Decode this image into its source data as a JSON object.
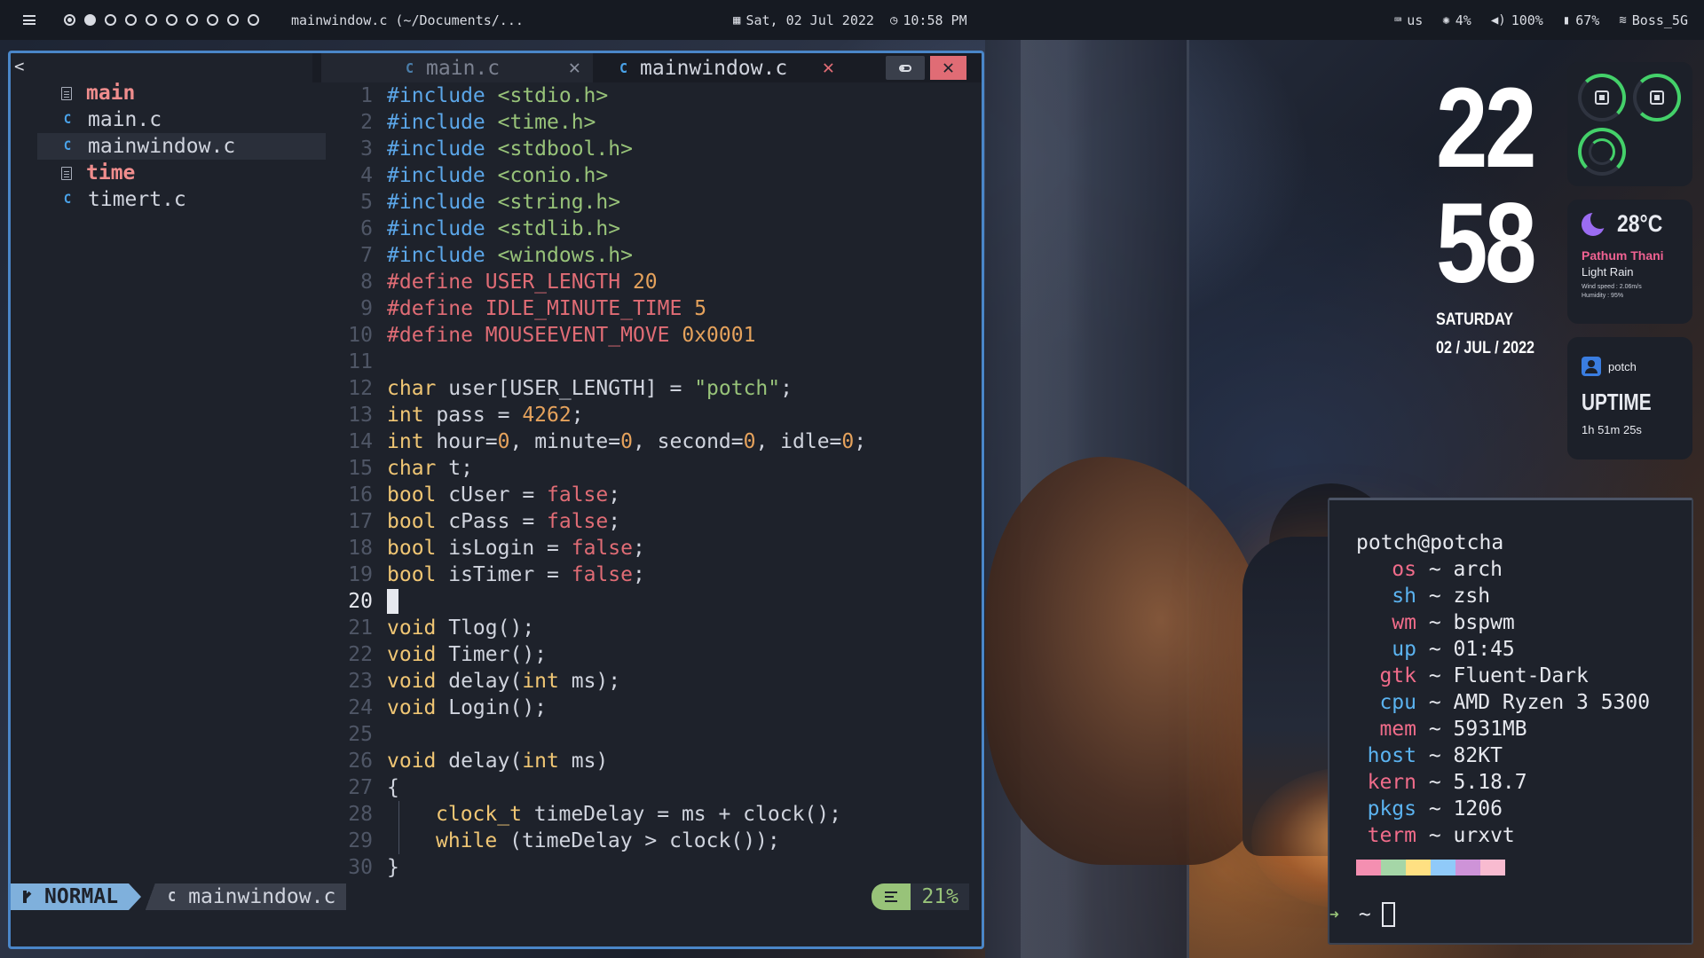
{
  "topbar": {
    "workspaces": [
      "1",
      "2",
      "3",
      "4",
      "5",
      "6",
      "7",
      "8",
      "9",
      "10"
    ],
    "window_title": "mainwindow.c (~/Documents/...",
    "date": "Sat, 02 Jul 2022",
    "time": "10:58 PM",
    "keyboard": "us",
    "brightness": "4%",
    "volume": "100%",
    "battery": "67%",
    "wifi": "Boss_5G"
  },
  "editor": {
    "tree_back": "<",
    "tree": [
      {
        "name": "main",
        "kind": "exec"
      },
      {
        "name": "main.c",
        "kind": "c"
      },
      {
        "name": "mainwindow.c",
        "kind": "c"
      },
      {
        "name": "time",
        "kind": "exec"
      },
      {
        "name": "timert.c",
        "kind": "c"
      }
    ],
    "tabs": [
      {
        "label": "main.c",
        "active": false
      },
      {
        "label": "mainwindow.c",
        "active": true
      }
    ],
    "current_line": "20",
    "lines": [
      {
        "n": "1",
        "tokens": [
          [
            "inc",
            "#include "
          ],
          [
            "hdr",
            "<stdio.h>"
          ]
        ]
      },
      {
        "n": "2",
        "tokens": [
          [
            "inc",
            "#include "
          ],
          [
            "hdr",
            "<time.h>"
          ]
        ]
      },
      {
        "n": "3",
        "tokens": [
          [
            "inc",
            "#include "
          ],
          [
            "hdr",
            "<stdbool.h>"
          ]
        ]
      },
      {
        "n": "4",
        "tokens": [
          [
            "inc",
            "#include "
          ],
          [
            "hdr",
            "<conio.h>"
          ]
        ]
      },
      {
        "n": "5",
        "tokens": [
          [
            "inc",
            "#include "
          ],
          [
            "hdr",
            "<string.h>"
          ]
        ]
      },
      {
        "n": "6",
        "tokens": [
          [
            "inc",
            "#include "
          ],
          [
            "hdr",
            "<stdlib.h>"
          ]
        ]
      },
      {
        "n": "7",
        "tokens": [
          [
            "inc",
            "#include "
          ],
          [
            "hdr",
            "<windows.h>"
          ]
        ]
      },
      {
        "n": "8",
        "tokens": [
          [
            "def",
            "#define USER_LENGTH "
          ],
          [
            "num",
            "20"
          ]
        ]
      },
      {
        "n": "9",
        "tokens": [
          [
            "def",
            "#define IDLE_MINUTE_TIME "
          ],
          [
            "num",
            "5"
          ]
        ]
      },
      {
        "n": "10",
        "tokens": [
          [
            "def",
            "#define MOUSEEVENT_MOVE "
          ],
          [
            "num",
            "0x0001"
          ]
        ]
      },
      {
        "n": "11",
        "tokens": []
      },
      {
        "n": "12",
        "tokens": [
          [
            "k2",
            "char"
          ],
          [
            "p",
            " user[USER_LENGTH] = "
          ],
          [
            "str",
            "\"potch\""
          ],
          [
            "p",
            ";"
          ]
        ]
      },
      {
        "n": "13",
        "tokens": [
          [
            "k2",
            "int"
          ],
          [
            "p",
            " pass = "
          ],
          [
            "num",
            "4262"
          ],
          [
            "p",
            ";"
          ]
        ]
      },
      {
        "n": "14",
        "tokens": [
          [
            "k2",
            "int"
          ],
          [
            "p",
            " hour="
          ],
          [
            "num",
            "0"
          ],
          [
            "p",
            ", minute="
          ],
          [
            "num",
            "0"
          ],
          [
            "p",
            ", second="
          ],
          [
            "num",
            "0"
          ],
          [
            "p",
            ", idle="
          ],
          [
            "num",
            "0"
          ],
          [
            "p",
            ";"
          ]
        ]
      },
      {
        "n": "15",
        "tokens": [
          [
            "k2",
            "char"
          ],
          [
            "p",
            " t;"
          ]
        ]
      },
      {
        "n": "16",
        "tokens": [
          [
            "k2",
            "bool"
          ],
          [
            "p",
            " cUser = "
          ],
          [
            "fal",
            "false"
          ],
          [
            "p",
            ";"
          ]
        ]
      },
      {
        "n": "17",
        "tokens": [
          [
            "k2",
            "bool"
          ],
          [
            "p",
            " cPass = "
          ],
          [
            "fal",
            "false"
          ],
          [
            "p",
            ";"
          ]
        ]
      },
      {
        "n": "18",
        "tokens": [
          [
            "k2",
            "bool"
          ],
          [
            "p",
            " isLogin = "
          ],
          [
            "fal",
            "false"
          ],
          [
            "p",
            ";"
          ]
        ]
      },
      {
        "n": "19",
        "tokens": [
          [
            "k2",
            "bool"
          ],
          [
            "p",
            " isTimer = "
          ],
          [
            "fal",
            "false"
          ],
          [
            "p",
            ";"
          ]
        ]
      },
      {
        "n": "20",
        "tokens": [],
        "cursor": true
      },
      {
        "n": "21",
        "tokens": [
          [
            "k2",
            "void"
          ],
          [
            "p",
            " Tlog();"
          ]
        ]
      },
      {
        "n": "22",
        "tokens": [
          [
            "k2",
            "void"
          ],
          [
            "p",
            " Timer();"
          ]
        ]
      },
      {
        "n": "23",
        "tokens": [
          [
            "k2",
            "void"
          ],
          [
            "p",
            " delay("
          ],
          [
            "k2",
            "int"
          ],
          [
            "p",
            " ms);"
          ]
        ]
      },
      {
        "n": "24",
        "tokens": [
          [
            "k2",
            "void"
          ],
          [
            "p",
            " Login();"
          ]
        ]
      },
      {
        "n": "25",
        "tokens": []
      },
      {
        "n": "26",
        "tokens": [
          [
            "k2",
            "void"
          ],
          [
            "p",
            " delay("
          ],
          [
            "k2",
            "int"
          ],
          [
            "p",
            " ms)"
          ]
        ]
      },
      {
        "n": "27",
        "tokens": [
          [
            "p",
            "{"
          ]
        ]
      },
      {
        "n": "28",
        "indent": true,
        "tokens": [
          [
            "k2",
            "clock_t"
          ],
          [
            "p",
            " timeDelay = ms + clock();"
          ]
        ]
      },
      {
        "n": "29",
        "indent": true,
        "tokens": [
          [
            "k2",
            "while"
          ],
          [
            "p",
            " (timeDelay > clock());"
          ]
        ]
      },
      {
        "n": "30",
        "tokens": [
          [
            "p",
            "}"
          ]
        ]
      }
    ],
    "status": {
      "mode": "NORMAL",
      "file": "mainwindow.c",
      "percent": "21%"
    }
  },
  "clock": {
    "hour": "22",
    "minute": "58",
    "day": "SATURDAY",
    "date": "02 / JUL / 2022"
  },
  "weather": {
    "temp": "28°C",
    "location": "Pathum Thani",
    "condition": "Light Rain",
    "wind": "Wind speed : 2.06m/s",
    "humidity": "Humidity : 95%"
  },
  "uptime": {
    "user": "potch",
    "label": "UPTIME",
    "value": "1h 51m 25s"
  },
  "terminal": {
    "user_host": "potch@potcha",
    "rows": [
      {
        "k": "os",
        "v": "arch",
        "c": "c1"
      },
      {
        "k": "sh",
        "v": "zsh",
        "c": "c2"
      },
      {
        "k": "wm",
        "v": "bspwm",
        "c": "c1"
      },
      {
        "k": "up",
        "v": "01:45",
        "c": "c2"
      },
      {
        "k": "gtk",
        "v": "Fluent-Dark",
        "c": "c1"
      },
      {
        "k": "cpu",
        "v": "AMD Ryzen 3 5300",
        "c": "c2"
      },
      {
        "k": "mem",
        "v": "5931MB",
        "c": "c1"
      },
      {
        "k": "host",
        "v": "82KT",
        "c": "c2"
      },
      {
        "k": "kern",
        "v": "5.18.7",
        "c": "c1"
      },
      {
        "k": "pkgs",
        "v": "1206",
        "c": "c2"
      },
      {
        "k": "term",
        "v": "urxvt",
        "c": "c1"
      }
    ],
    "palette": [
      "#f48fb1",
      "#a5d6a7",
      "#ffe082",
      "#90caf9",
      "#ce93d8",
      "#f8bbd0"
    ],
    "prompt_symbol": "~"
  }
}
